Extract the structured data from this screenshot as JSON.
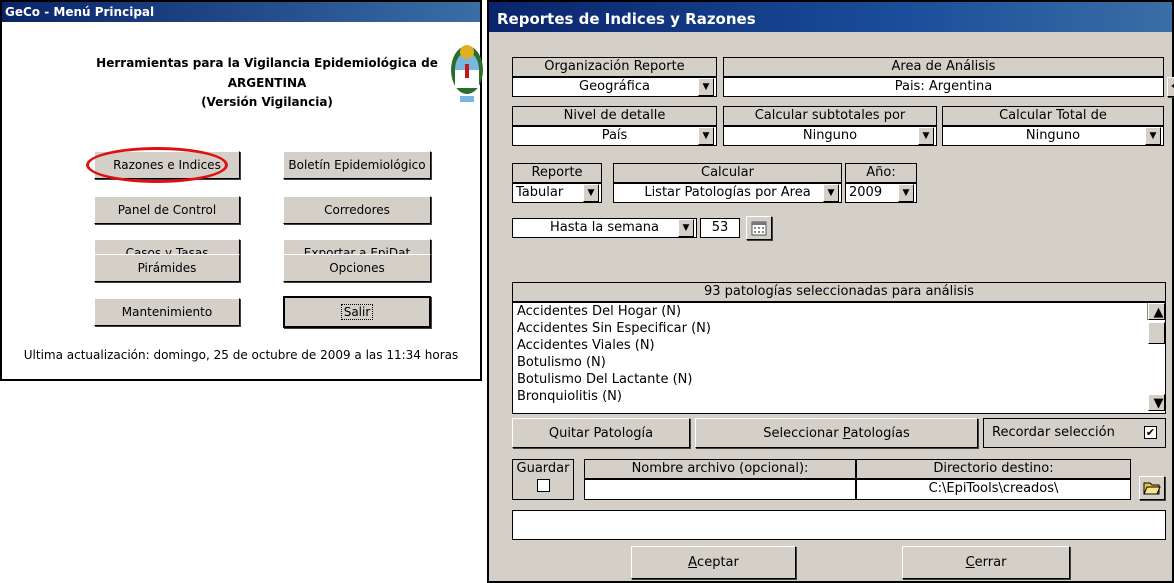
{
  "menu": {
    "title": "GeCo - Menú Principal",
    "heading_line1": "Herramientas para la Vigilancia Epidemiológica de",
    "heading_line2": "ARGENTINA",
    "heading_line3": "(Versión Vigilancia)",
    "buttons": {
      "razones": "Razones e Indices",
      "boletin": "Boletín Epidemiológico",
      "panel": "Panel de Control",
      "corredores": "Corredores",
      "casos": "Casos y Tasas",
      "exportar": "Exportar a EpiDat",
      "piramides": "Pirámides",
      "opciones": "Opciones",
      "mantenimiento": "Mantenimiento",
      "salir": "Salir"
    },
    "update_text": "Ultima actualización: domingo, 25 de octubre de 2009 a las 11:34 horas",
    "highlight_color": "#e01010"
  },
  "reportes": {
    "title": "Reportes de Indices y Razones",
    "org_label": "Organización Reporte",
    "org_value": "Geográfica",
    "area_label": "Area de Análisis",
    "area_value": "Pais: Argentina",
    "nivel_label": "Nivel de detalle",
    "nivel_value": "País",
    "subtot_label": "Calcular subtotales por",
    "subtot_value": "Ninguno",
    "total_label": "Calcular Total de",
    "total_value": "Ninguno",
    "reporte_label": "Reporte",
    "reporte_value": "Tabular",
    "calcular_label": "Calcular",
    "calcular_value": "Listar Patologías por Area",
    "anio_label": "Año:",
    "anio_value": "2009",
    "hasta_value": "Hasta la semana",
    "semana_value": "53",
    "patologias_header": "93 patologías seleccionadas para análisis",
    "patologias": [
      "Accidentes Del Hogar (N)",
      "Accidentes Sin Especificar (N)",
      "Accidentes Viales (N)",
      "Botulismo (N)",
      "Botulismo Del Lactante (N)",
      "Bronquiolitis (N)"
    ],
    "quitar": "Quitar Patología",
    "seleccionar_pre": "Seleccionar ",
    "seleccionar_u": "P",
    "seleccionar_post": "atologías",
    "recordar": "Recordar selección",
    "guardar": "Guardar",
    "nombre_label": "Nombre archivo (opcional):",
    "dir_label": "Directorio destino:",
    "dir_value": "C:\\EpiTools\\creados\\",
    "aceptar_u": "A",
    "aceptar_rest": "ceptar",
    "cerrar_u": "C",
    "cerrar_rest": "errar"
  }
}
